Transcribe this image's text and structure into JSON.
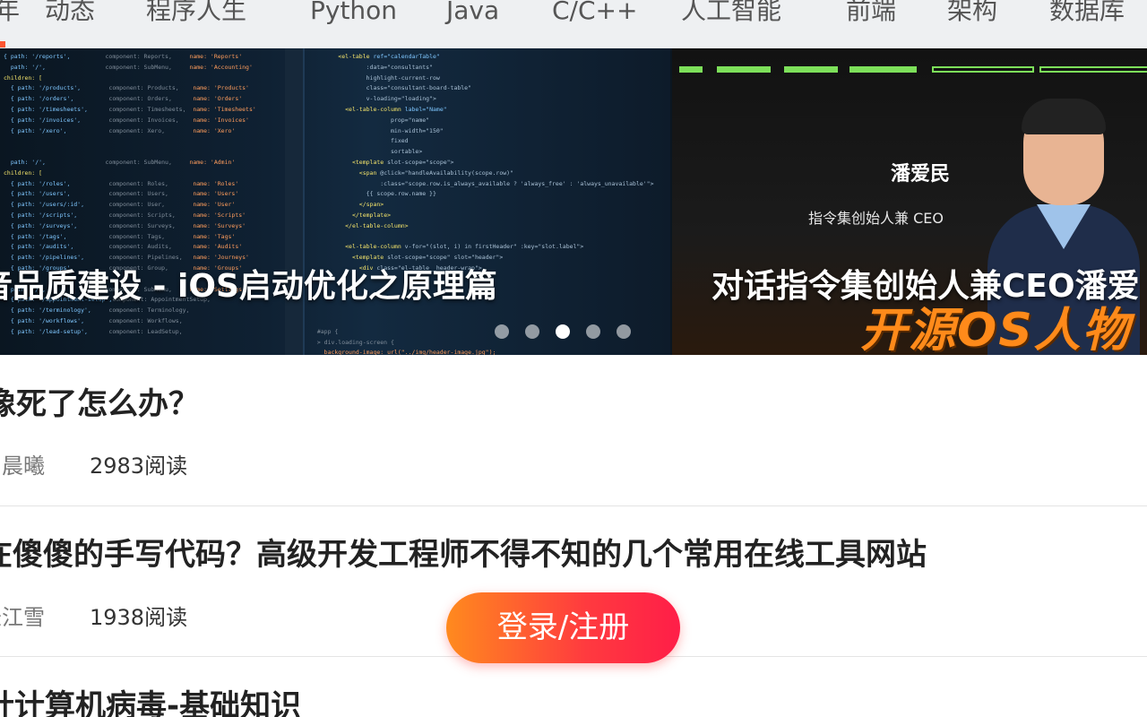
{
  "nav": {
    "items": [
      "年",
      "动态",
      "程序人生",
      "Python",
      "Java",
      "C/C++",
      "人工智能",
      "前端",
      "架构",
      "数据库"
    ]
  },
  "banner": {
    "slides": [
      {
        "title": "音品质建设 - iOS启动优化之原理篇"
      },
      {
        "title": "对话指令集创始人兼CEO潘爱",
        "person_name": "潘爱民",
        "person_role": "指令集创始人兼 CEO",
        "logo_text": "开源OS人物"
      }
    ],
    "dots_count": 5,
    "active_dot": 2
  },
  "feed": [
    {
      "title": "像死了怎么办？",
      "author": "与晨曦",
      "reads": "2983阅读"
    },
    {
      "title": "在傻傻的手写代码？高级开发工程师不得不知的几个常用在线工具网站",
      "author": "长江雪",
      "reads": "1938阅读"
    },
    {
      "title": "针计算机病毒-基础知识"
    }
  ],
  "login_button": {
    "label": "登录/注册"
  },
  "colors": {
    "accent": "#fc5531",
    "login_start": "#ff8a1e",
    "login_end": "#ff1e48",
    "code_keyword": "#f5e56b",
    "code_tag": "#7fc7ff"
  }
}
